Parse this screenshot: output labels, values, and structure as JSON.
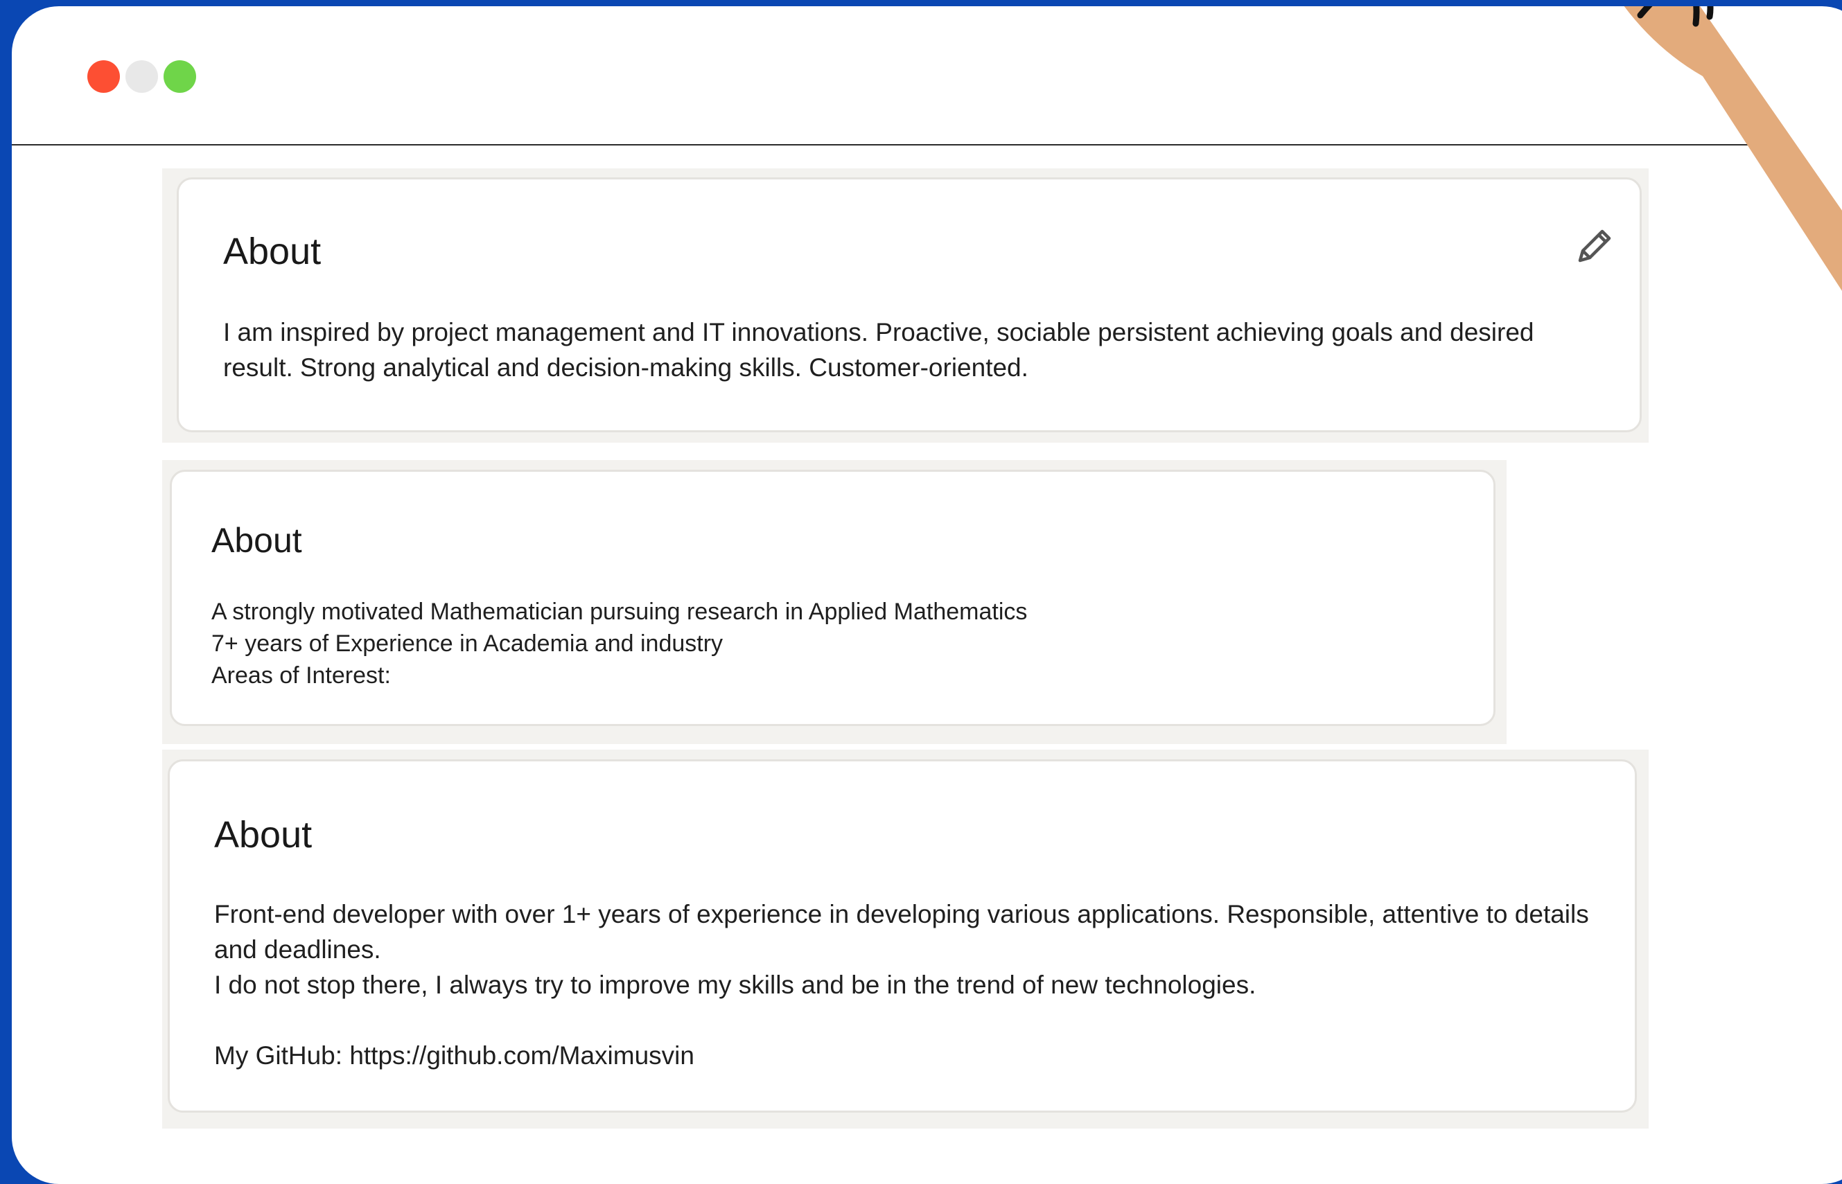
{
  "window": {
    "controls": [
      {
        "name": "close",
        "color": "#fd4f33"
      },
      {
        "name": "minimize",
        "color": "#e8e8e8"
      },
      {
        "name": "maximize",
        "color": "#6fd549"
      }
    ]
  },
  "cards": [
    {
      "heading": "About",
      "text": "I am inspired by project management and IT innovations. Proactive, sociable persistent achieving goals and desired result. Strong analytical and decision-making skills. Customer-oriented.",
      "edit_icon": "pencil-icon"
    },
    {
      "heading": "About",
      "text": "A strongly motivated Mathematician pursuing research in Applied Mathematics\n7+ years of Experience in Academia and industry\nAreas of Interest:"
    },
    {
      "heading": "About",
      "text": "Front-end developer with over 1+ years of experience in developing various applications. Responsible, attentive to details and deadlines.\nI do not stop there, I always try to improve my skills and be in the trend of new technologies.\n\nMy GitHub: https://github.com/Maximusvin"
    }
  ],
  "colors": {
    "frame": "#0a47b3",
    "panel": "#f3f2ef",
    "hand": "#e3ab7c"
  }
}
